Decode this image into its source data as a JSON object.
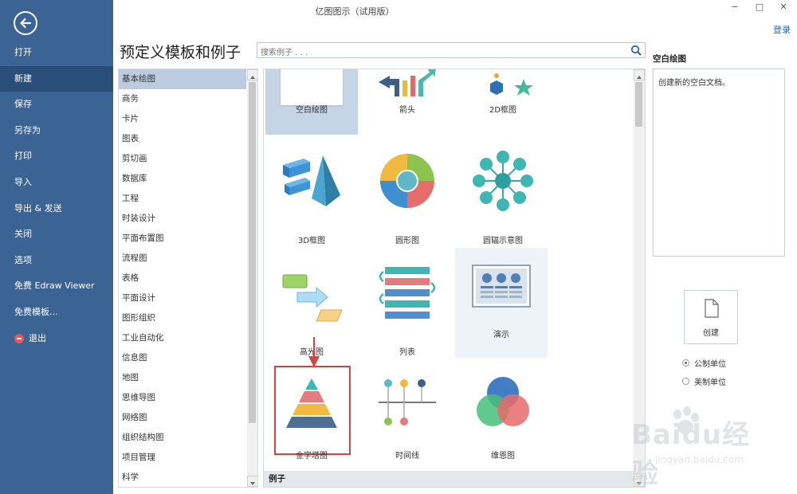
{
  "window": {
    "title": "亿图图示（试用版）",
    "minimize": "−",
    "maximize": "□",
    "close": "✕",
    "login": "登录"
  },
  "sidebar": {
    "items": [
      {
        "label": "打开"
      },
      {
        "label": "新建",
        "active": true
      },
      {
        "label": "保存"
      },
      {
        "label": "另存为"
      },
      {
        "label": "打印"
      },
      {
        "label": "导入"
      },
      {
        "label": "导出 & 发送"
      },
      {
        "label": "关闭"
      },
      {
        "label": "选项"
      },
      {
        "label": "免费 Edraw Viewer"
      },
      {
        "label": "免费模板..."
      },
      {
        "label": "退出"
      }
    ]
  },
  "main": {
    "heading": "预定义模板和例子",
    "search_placeholder": "搜索例子 . . ."
  },
  "categories": [
    "基本绘图",
    "商务",
    "卡片",
    "图表",
    "剪切画",
    "数据库",
    "工程",
    "时装设计",
    "平面布置图",
    "流程图",
    "表格",
    "平面设计",
    "图形组织",
    "工业自动化",
    "信息图",
    "地图",
    "思维导图",
    "网络图",
    "组织结构图",
    "项目管理",
    "科学"
  ],
  "templates": [
    {
      "label": "空白绘图",
      "state": "selected"
    },
    {
      "label": "箭头"
    },
    {
      "label": "2D框图"
    },
    {
      "label": "3D框图"
    },
    {
      "label": "圆形图"
    },
    {
      "label": "圆辐示意图"
    },
    {
      "label": "高光图"
    },
    {
      "label": "列表"
    },
    {
      "label": "演示",
      "state": "hover"
    },
    {
      "label": "金字塔图",
      "highlighted": true
    },
    {
      "label": "时间线"
    },
    {
      "label": "维恩图"
    }
  ],
  "section_label": "例子",
  "right_panel": {
    "title": "空白绘图",
    "description": "创建新的空白文档。",
    "create_label": "创建",
    "units": [
      {
        "label": "公制单位",
        "checked": true
      },
      {
        "label": "美制单位",
        "checked": false
      }
    ]
  },
  "watermark": {
    "text": "Baidu经验",
    "sub": "jingyan.baidu.com"
  },
  "colors": {
    "sidebar": "#3b6494",
    "sidebar_active": "#2a4e7a",
    "highlight": "#d64343",
    "selected_tile": "#c5d4e6"
  }
}
